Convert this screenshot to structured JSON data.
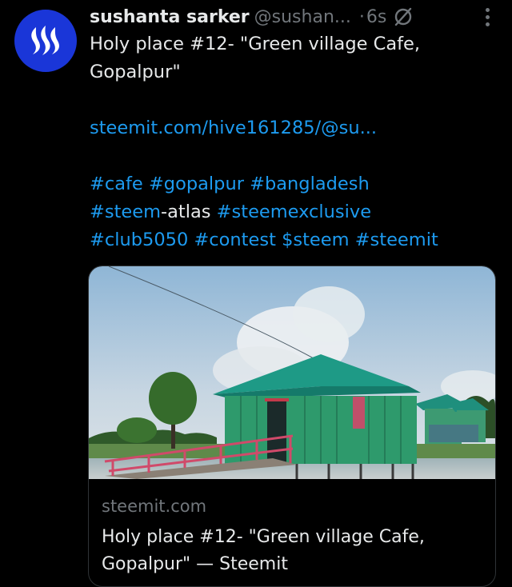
{
  "post": {
    "author_name": "sushanta sarker",
    "author_handle": "@sushan...",
    "separator": "·",
    "time_ago": "6s",
    "icons": {
      "avatar": "steem-logo-icon",
      "status": "circle-slash-icon",
      "menu": "more-options-icon"
    },
    "text_line": "Holy place #12- \"Green village Cafe, Gopalpur\"",
    "link": "steemit.com/hive161285/@su...",
    "tags_line1": [
      "#cafe",
      "#gopalpur",
      "#bangladesh"
    ],
    "tags_line2_tag": "#steem",
    "tags_line2_text": "-atlas",
    "tags_line2_tag2": "#steemexclusive",
    "tags_line3": [
      "#club5050",
      "#contest",
      "$steem",
      "#steemit"
    ]
  },
  "card": {
    "domain": "steemit.com",
    "title": "Holy place #12- \"Green village Cafe, Gopalpur\" — Steemit"
  },
  "colors": {
    "background": "#000000",
    "text": "#e7e9ea",
    "muted": "#71767b",
    "link": "#1d9bf0",
    "avatar_bg": "#1a36d8"
  }
}
